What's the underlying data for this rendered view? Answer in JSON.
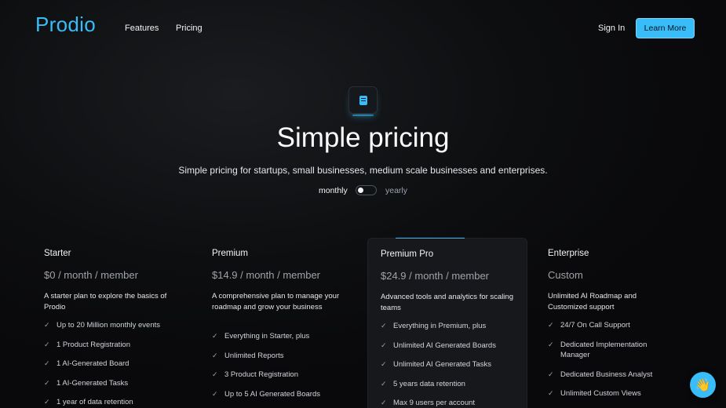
{
  "nav": {
    "logo": "Prodio",
    "links": [
      "Features",
      "Pricing"
    ],
    "sign_in": "Sign In",
    "cta": "Learn More"
  },
  "hero": {
    "icon": "document-icon",
    "title": "Simple pricing",
    "subtitle": "Simple pricing for startups, small businesses, medium scale businesses and enterprises.",
    "toggle": {
      "left_label": "monthly",
      "right_label": "yearly",
      "selected": "monthly"
    }
  },
  "plans": [
    {
      "name": "Starter",
      "price": "$0 / month / member",
      "description": "A starter plan to explore the basics of Prodio",
      "features": [
        "Up to 20 Million monthly events",
        "1 Product Registration",
        "1 AI-Generated Board",
        "1 AI-Generated Tasks",
        "1 year of data retention"
      ]
    },
    {
      "name": "Premium",
      "price": "$14.9 / month / member",
      "description": "A comprehensive plan to manage your roadmap and grow your business",
      "features": [
        "Everything in Starter, plus",
        "Unlimited Reports",
        "3 Product Registration",
        "Up to 5 AI Generated Boards"
      ]
    },
    {
      "name": "Premium Pro",
      "price": "$24.9 / month / member",
      "description": "Advanced tools and analytics for scaling teams",
      "features": [
        "Everything in Premium, plus",
        "Unlimited AI Generated Boards",
        "Unlimited AI Generated Tasks",
        "5 years data retention",
        "Max 9 users per account"
      ]
    },
    {
      "name": "Enterprise",
      "price": "Custom",
      "description": "Unlimited AI Roadmap and Customized support",
      "features": [
        "24/7 On Call Support",
        "Dedicated Implementation Manager",
        "Dedicated Business Analyst",
        "Unlimited Custom Views"
      ]
    }
  ],
  "chat": {
    "icon": "waving-hand-icon",
    "glyph": "👋"
  },
  "colors": {
    "accent": "#38bdf8",
    "background": "#09090b"
  }
}
